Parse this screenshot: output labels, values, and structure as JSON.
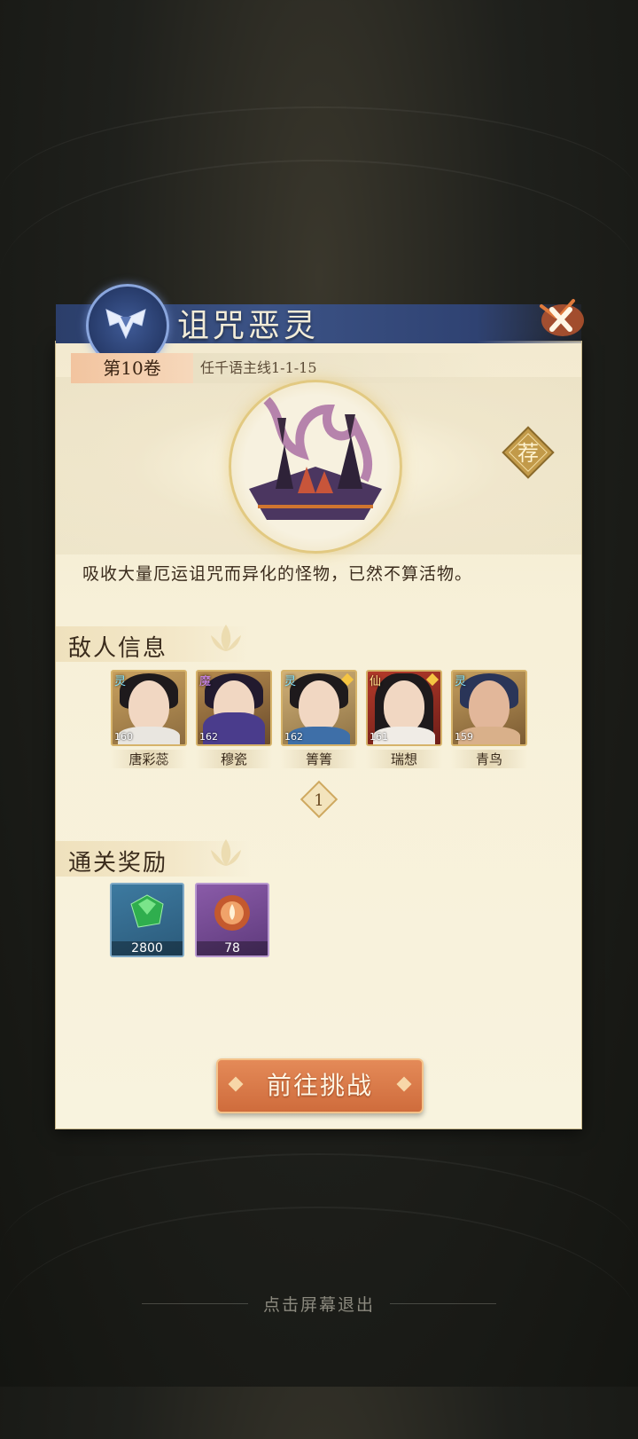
{
  "stage": {
    "title": "诅咒恶灵",
    "volume": "第10卷",
    "quest_path": "任千语主线1-1-15",
    "recommend_badge": "荐",
    "description": "吸收大量厄运诅咒而异化的怪物，已然不算活物。"
  },
  "enemy_section": {
    "heading": "敌人信息",
    "enemies": [
      {
        "name": "唐彩蕊",
        "level": "160",
        "faction": "灵"
      },
      {
        "name": "穆瓷",
        "level": "162",
        "faction": "魔"
      },
      {
        "name": "箐箐",
        "level": "162",
        "faction": "灵"
      },
      {
        "name": "瑞想",
        "level": "161",
        "faction": "仙"
      },
      {
        "name": "青鸟",
        "level": "159",
        "faction": "灵"
      }
    ],
    "page_indicator": "1"
  },
  "reward_section": {
    "heading": "通关奖励",
    "rewards": [
      {
        "icon": "green-gem-icon",
        "count": "2800"
      },
      {
        "icon": "lotus-orb-icon",
        "count": "78"
      }
    ]
  },
  "challenge_button": "前往挑战",
  "exit_hint": "点击屏幕退出",
  "colors": {
    "title_bar": "#3c5386",
    "panel": "#f7f0d8",
    "button": "#d9784a",
    "text_dark": "#3a2b1c"
  }
}
